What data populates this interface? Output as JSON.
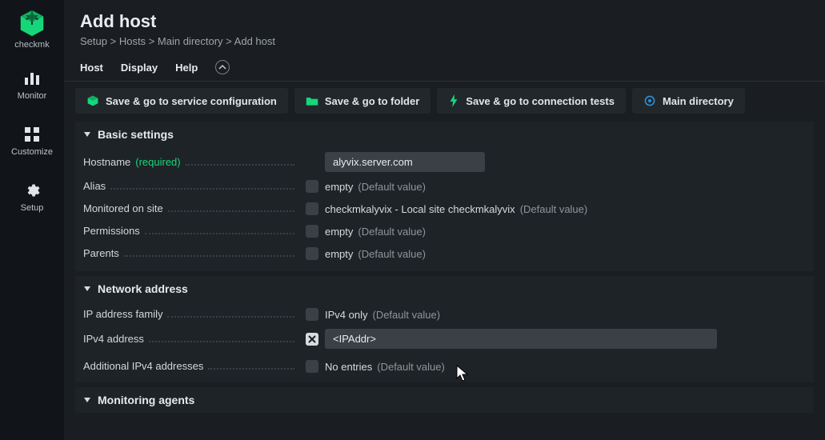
{
  "brand": {
    "name": "checkmk"
  },
  "sidebar": {
    "items": [
      {
        "label": "Monitor"
      },
      {
        "label": "Customize"
      },
      {
        "label": "Setup"
      }
    ]
  },
  "header": {
    "title": "Add host",
    "breadcrumbs": [
      "Setup",
      "Hosts",
      "Main directory",
      "Add host"
    ],
    "breadcrumb_sep": " > "
  },
  "menubar": {
    "items": [
      "Host",
      "Display",
      "Help"
    ]
  },
  "actions": {
    "save_service": "Save & go to service configuration",
    "save_folder": "Save & go to folder",
    "save_conn": "Save & go to connection tests",
    "main_dir": "Main directory"
  },
  "sections": {
    "basic": {
      "title": "Basic settings",
      "hostname_label": "Hostname",
      "hostname_required": "(required)",
      "hostname_value": "alyvix.server.com",
      "alias_label": "Alias",
      "alias_value": "empty",
      "alias_default": "(Default value)",
      "monitored_label": "Monitored on site",
      "monitored_value": "checkmkalyvix - Local site checkmkalyvix",
      "monitored_default": "(Default value)",
      "permissions_label": "Permissions",
      "permissions_value": "empty",
      "permissions_default": "(Default value)",
      "parents_label": "Parents",
      "parents_value": "empty",
      "parents_default": "(Default value)"
    },
    "network": {
      "title": "Network address",
      "family_label": "IP address family",
      "family_value": "IPv4 only",
      "family_default": "(Default value)",
      "ipv4_label": "IPv4 address",
      "ipv4_value": "<IPAddr>",
      "addl_label": "Additional IPv4 addresses",
      "addl_value": "No entries",
      "addl_default": "(Default value)"
    },
    "agents": {
      "title": "Monitoring agents"
    }
  }
}
